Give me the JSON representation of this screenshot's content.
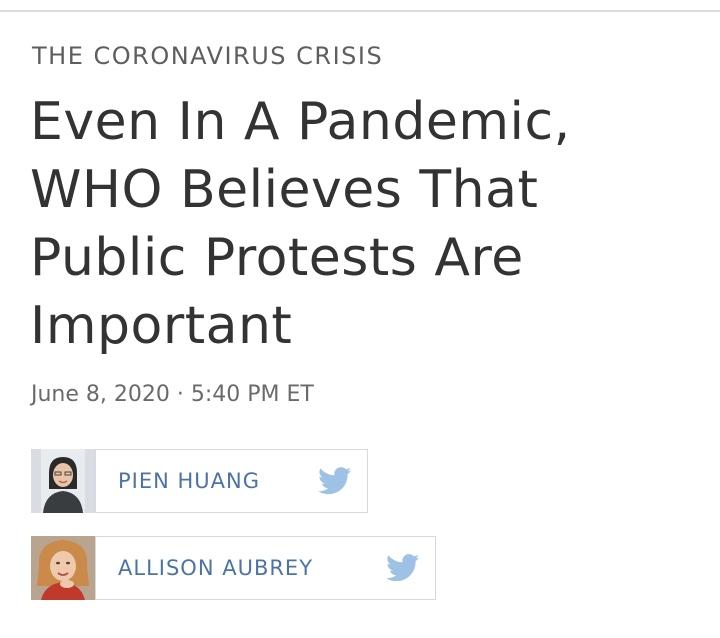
{
  "article": {
    "kicker": "THE CORONAVIRUS CRISIS",
    "headline": "Even In A Pandemic, WHO Believes That Public Protests Are Important",
    "dateline": "June 8, 2020 · 5:40 PM ET"
  },
  "authors": [
    {
      "name": "PIEN HUANG",
      "social_icon": "twitter-icon"
    },
    {
      "name": "ALLISON AUBREY",
      "social_icon": "twitter-icon"
    }
  ],
  "colors": {
    "author_link": "#4c73a6",
    "twitter_bird": "#9ec2e6",
    "headline": "#333333",
    "kicker": "#5e5e5e"
  }
}
